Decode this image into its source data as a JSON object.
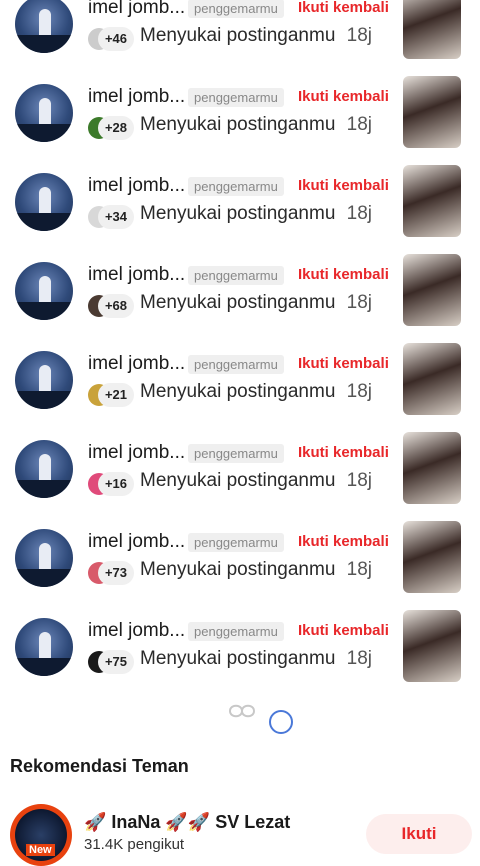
{
  "notifications": [
    {
      "name": "imel jomb...",
      "badge": "penggemarmu",
      "follow_back": "Ikuti kembali",
      "count": "+46",
      "action": "Menyukai postinganmu",
      "time": "18j",
      "mini_color": "#cccccc"
    },
    {
      "name": "imel jomb...",
      "badge": "penggemarmu",
      "follow_back": "Ikuti kembali",
      "count": "+28",
      "action": "Menyukai postinganmu",
      "time": "18j",
      "mini_color": "#3c7a2a"
    },
    {
      "name": "imel jomb...",
      "badge": "penggemarmu",
      "follow_back": "Ikuti kembali",
      "count": "+34",
      "action": "Menyukai postinganmu",
      "time": "18j",
      "mini_color": "#d8d8d8"
    },
    {
      "name": "imel jomb...",
      "badge": "penggemarmu",
      "follow_back": "Ikuti kembali",
      "count": "+68",
      "action": "Menyukai postinganmu",
      "time": "18j",
      "mini_color": "#4a3a32"
    },
    {
      "name": "imel jomb...",
      "badge": "penggemarmu",
      "follow_back": "Ikuti kembali",
      "count": "+21",
      "action": "Menyukai postinganmu",
      "time": "18j",
      "mini_color": "#c9a23a"
    },
    {
      "name": "imel jomb...",
      "badge": "penggemarmu",
      "follow_back": "Ikuti kembali",
      "count": "+16",
      "action": "Menyukai postinganmu",
      "time": "18j",
      "mini_color": "#e04a7a"
    },
    {
      "name": "imel jomb...",
      "badge": "penggemarmu",
      "follow_back": "Ikuti kembali",
      "count": "+73",
      "action": "Menyukai postinganmu",
      "time": "18j",
      "mini_color": "#d85a6a"
    },
    {
      "name": "imel jomb...",
      "badge": "penggemarmu",
      "follow_back": "Ikuti kembali",
      "count": "+75",
      "action": "Menyukai postinganmu",
      "time": "18j",
      "mini_color": "#1a1a1a"
    }
  ],
  "recommendations": {
    "title": "Rekomendasi Teman",
    "user": {
      "name": "🚀 InaNa 🚀🚀 SV Lezat",
      "followers": "31.4K pengikut",
      "avatar_tag": "New",
      "follow_label": "Ikuti"
    }
  },
  "colors": {
    "accent": "#e8272a",
    "badge_bg": "#efefef",
    "follow_bg": "#fdeeed"
  }
}
